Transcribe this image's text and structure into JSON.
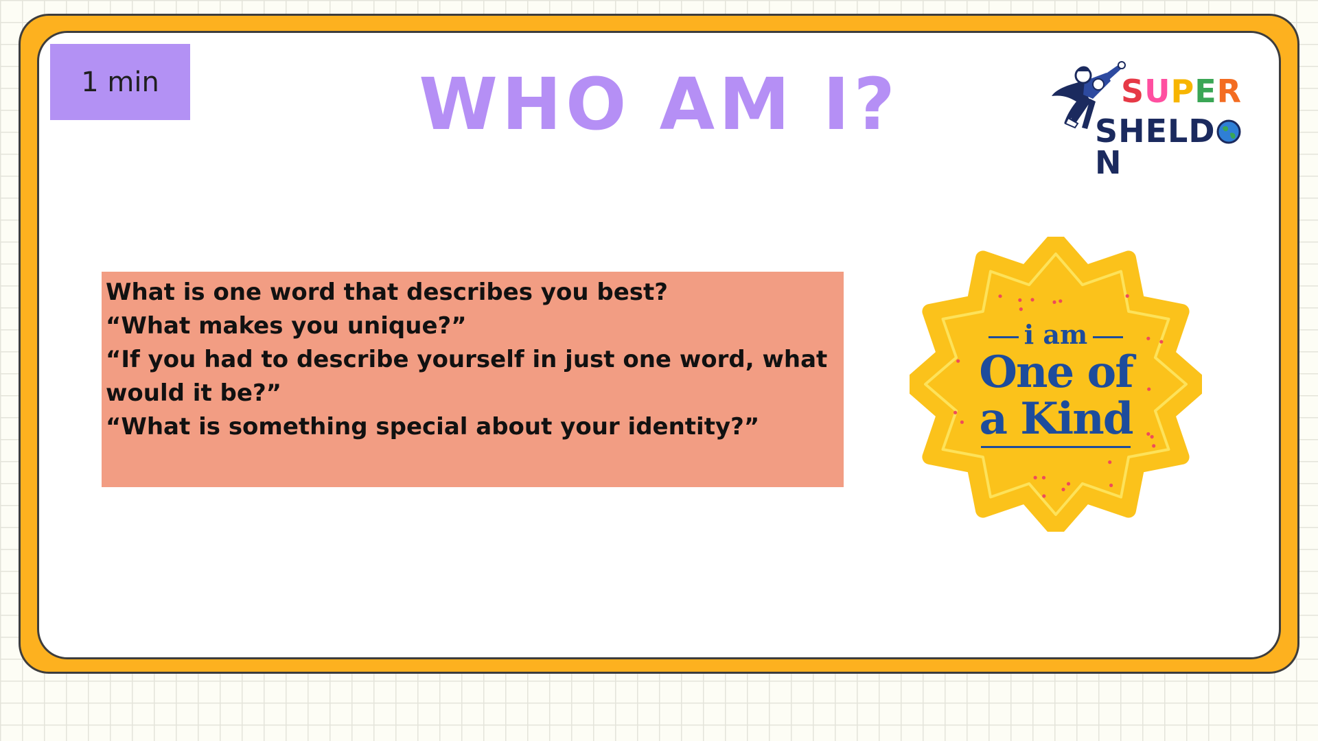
{
  "timer": {
    "label": "1 min"
  },
  "title": "WHO AM I?",
  "logo": {
    "super_letters": [
      {
        "char": "S",
        "color": "#e63946"
      },
      {
        "char": "U",
        "color": "#ff4fa0"
      },
      {
        "char": "P",
        "color": "#f7b500"
      },
      {
        "char": "E",
        "color": "#3aa655"
      },
      {
        "char": "R",
        "color": "#f36c21"
      }
    ],
    "sheldon_text": "SHELD",
    "sheldon_last": "N",
    "globe_icon": "globe-icon",
    "hero_icon": "flying-superhero-icon"
  },
  "questions": [
    "What is one word that describes you best?",
    "“What makes you unique?”",
    "“If you had to describe yourself in just one word, what would it be?”",
    "“What is something special about your identity?”"
  ],
  "badge": {
    "line1": "i am",
    "line2": "One of",
    "line3": "a Kind",
    "fill_color": "#fbc21b",
    "border_color": "#fde25a",
    "dot_color": "#ee4b5a",
    "text_color": "#1d4c9c"
  },
  "colors": {
    "frame": "#fdb11f",
    "title": "#b58ff5",
    "timer_bg": "#b391f4",
    "question_bg": "#f29d83"
  }
}
